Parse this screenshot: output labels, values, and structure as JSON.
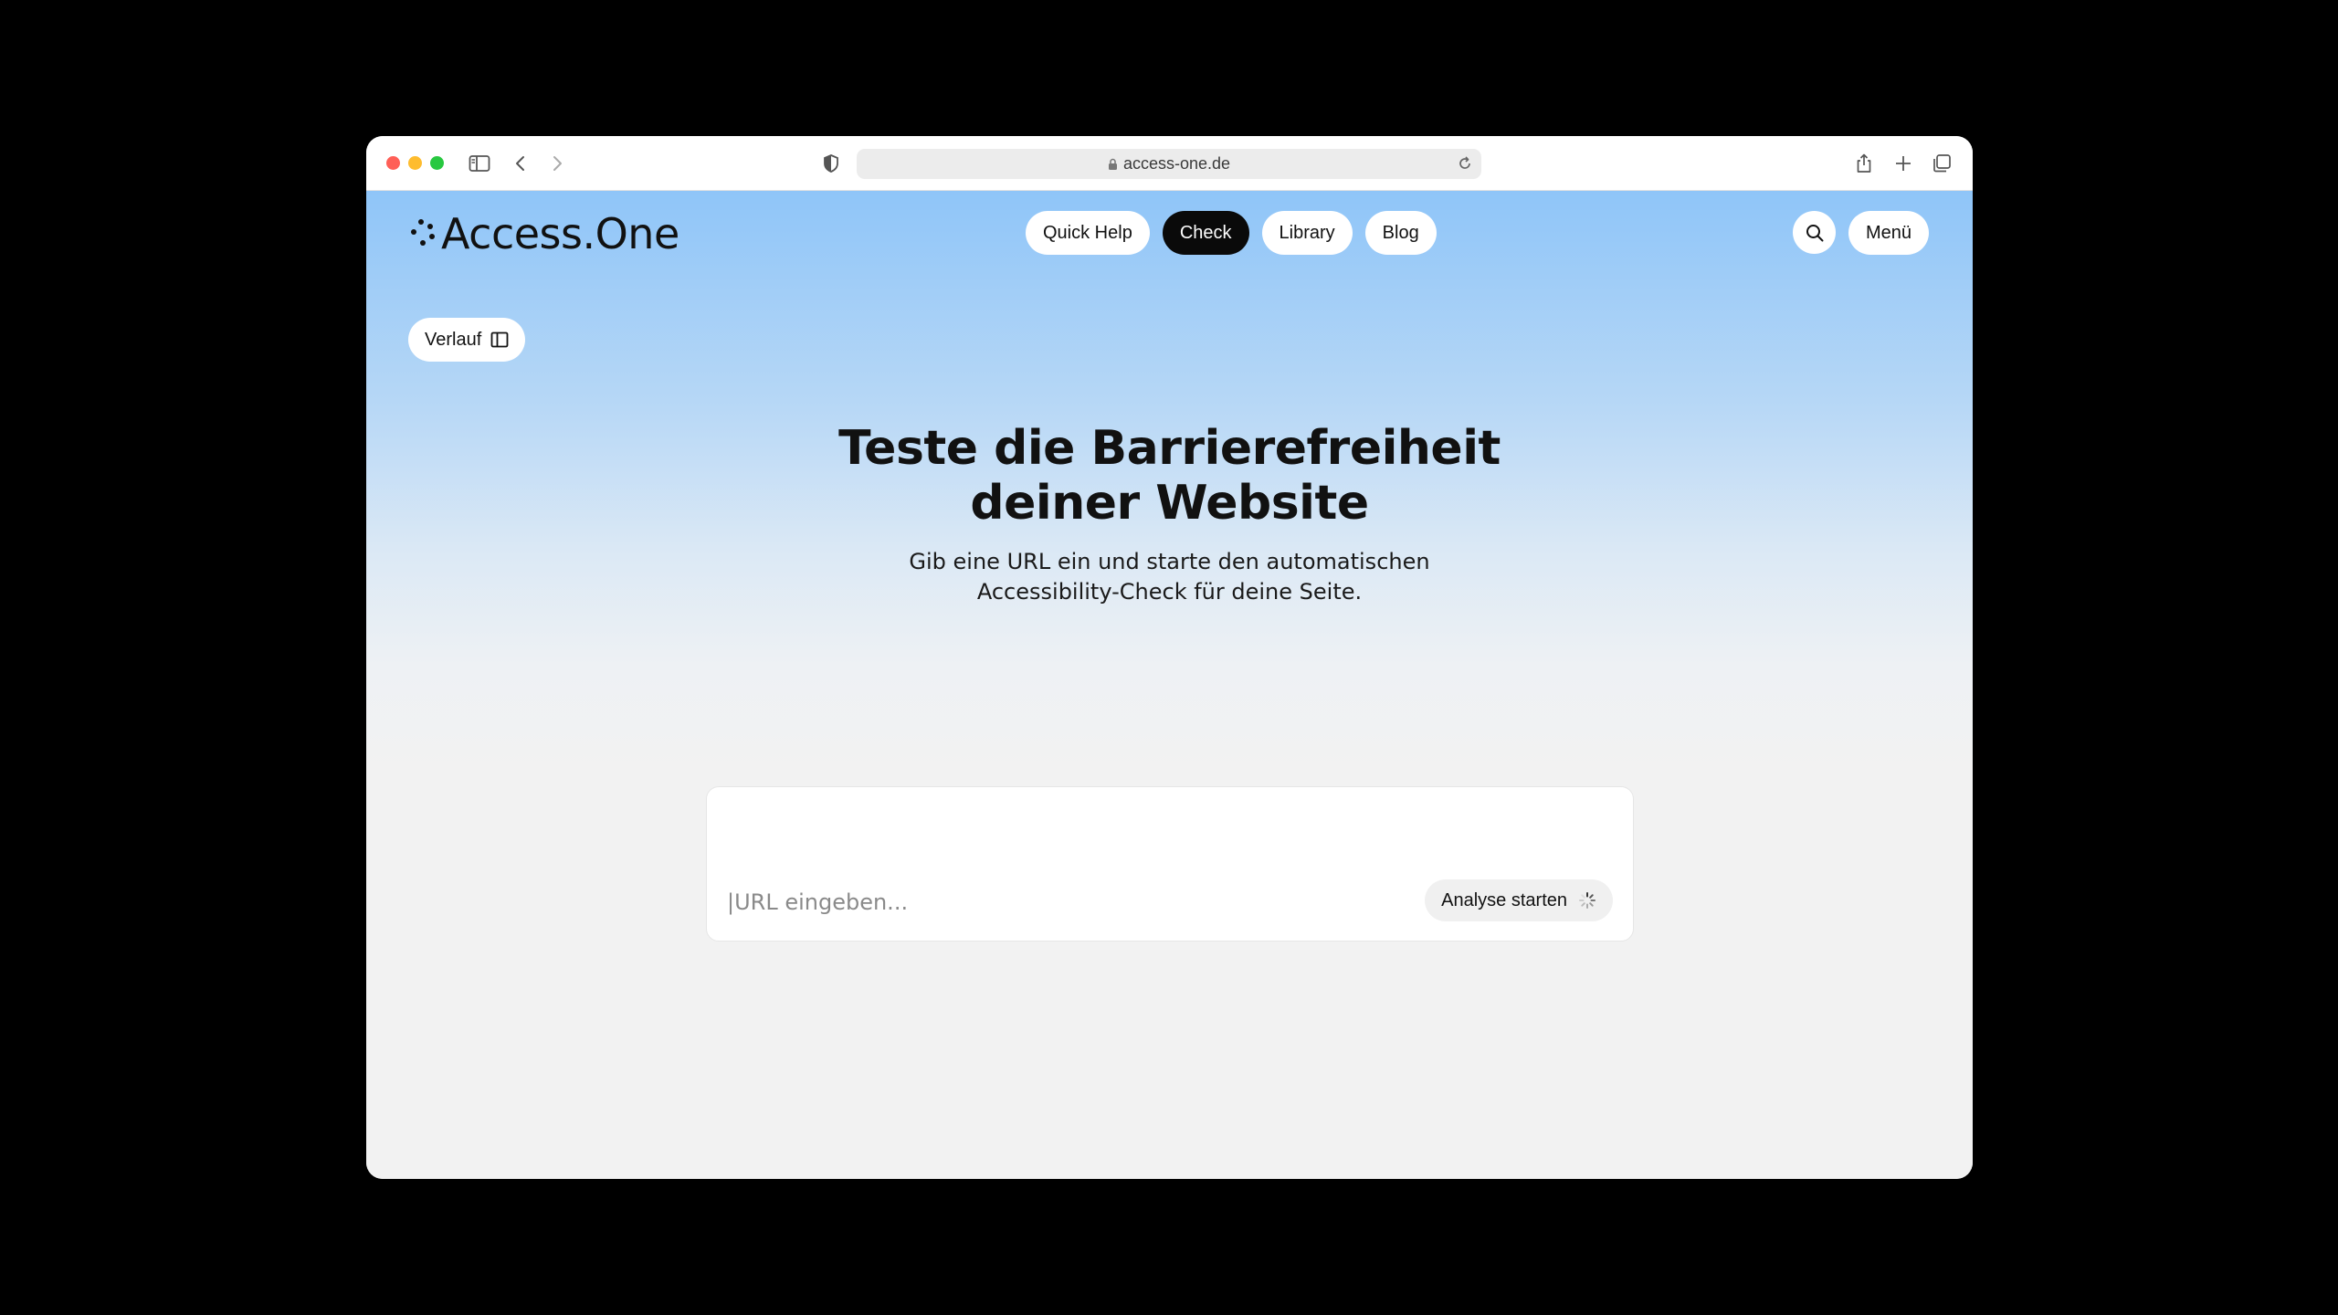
{
  "browser": {
    "url": "access-one.de"
  },
  "header": {
    "logo_text": "Access.One",
    "nav": [
      {
        "label": "Quick Help",
        "active": false
      },
      {
        "label": "Check",
        "active": true
      },
      {
        "label": "Library",
        "active": false
      },
      {
        "label": "Blog",
        "active": false
      }
    ],
    "menu_label": "Menü"
  },
  "sidebar_toggle": {
    "label": "Verlauf"
  },
  "hero": {
    "title_line1": "Teste die Barrierefreiheit",
    "title_line2": "deiner Website",
    "subtitle_line1": "Gib eine URL ein und starte den automatischen",
    "subtitle_line2": "Accessibility-Check für deine Seite."
  },
  "url_form": {
    "placeholder": "|URL eingeben...",
    "submit_label": "Analyse starten"
  },
  "colors": {
    "accent_dark": "#0a0a0a",
    "gradient_top": "#8fc5f8",
    "page_bg": "#f2f2f2"
  }
}
